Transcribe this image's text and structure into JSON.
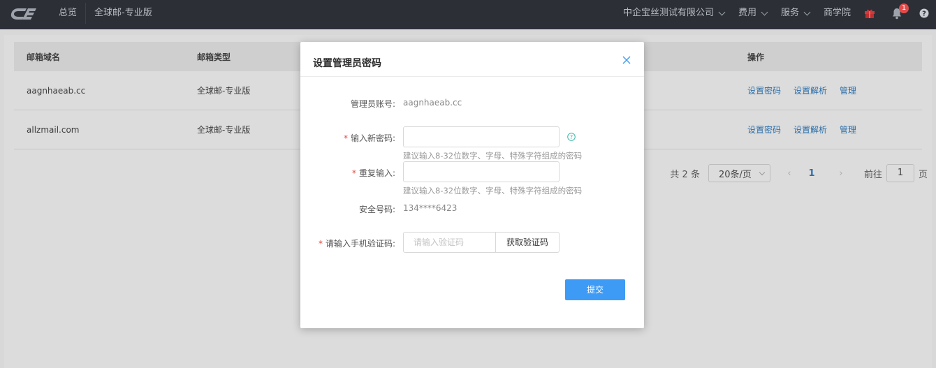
{
  "header": {
    "logo_text": "CE",
    "nav_left": [
      "总览",
      "全球邮-专业版"
    ],
    "company": "中企宝丝测试有限公司",
    "fees": "费用",
    "services": "服务",
    "academy": "商学院",
    "notification_count": "1",
    "icons": [
      "gift-icon",
      "bell-icon",
      "help-icon"
    ]
  },
  "table": {
    "headers": [
      "邮箱域名",
      "邮箱类型",
      "操作"
    ],
    "rows": [
      {
        "domain": "aagnhaeab.cc",
        "type": "全球邮-专业版",
        "actions": [
          "设置密码",
          "设置解析",
          "管理"
        ]
      },
      {
        "domain": "allzmail.com",
        "type": "全球邮-专业版",
        "actions": [
          "设置密码",
          "设置解析",
          "管理"
        ]
      }
    ]
  },
  "pagination": {
    "total": "共 2 条",
    "page_size": "20条/页",
    "current_page": "1",
    "goto_label": "前往",
    "goto_value": "1",
    "goto_unit": "页"
  },
  "modal": {
    "title": "设置管理员密码",
    "account_label": "管理员账号:",
    "account_value": "aagnhaeab.cc",
    "new_password_label": "输入新密码:",
    "new_password_hint": "建议输入8-32位数字、字母、特殊字符组成的密码",
    "repeat_label": "重复输入:",
    "repeat_hint": "建议输入8-32位数字、字母、特殊字符组成的密码",
    "security_label": "安全号码:",
    "security_value": "134****6423",
    "code_label": "请输入手机验证码:",
    "code_placeholder": "请输入验证码",
    "get_code_button": "获取验证码",
    "submit_button": "提交",
    "required_mark": "*"
  },
  "colors": {
    "topbar": "#2c2f36",
    "accent": "#3e9bf5",
    "link": "#2b6ea8",
    "required": "#e5483e",
    "badge": "#e24b4b"
  }
}
